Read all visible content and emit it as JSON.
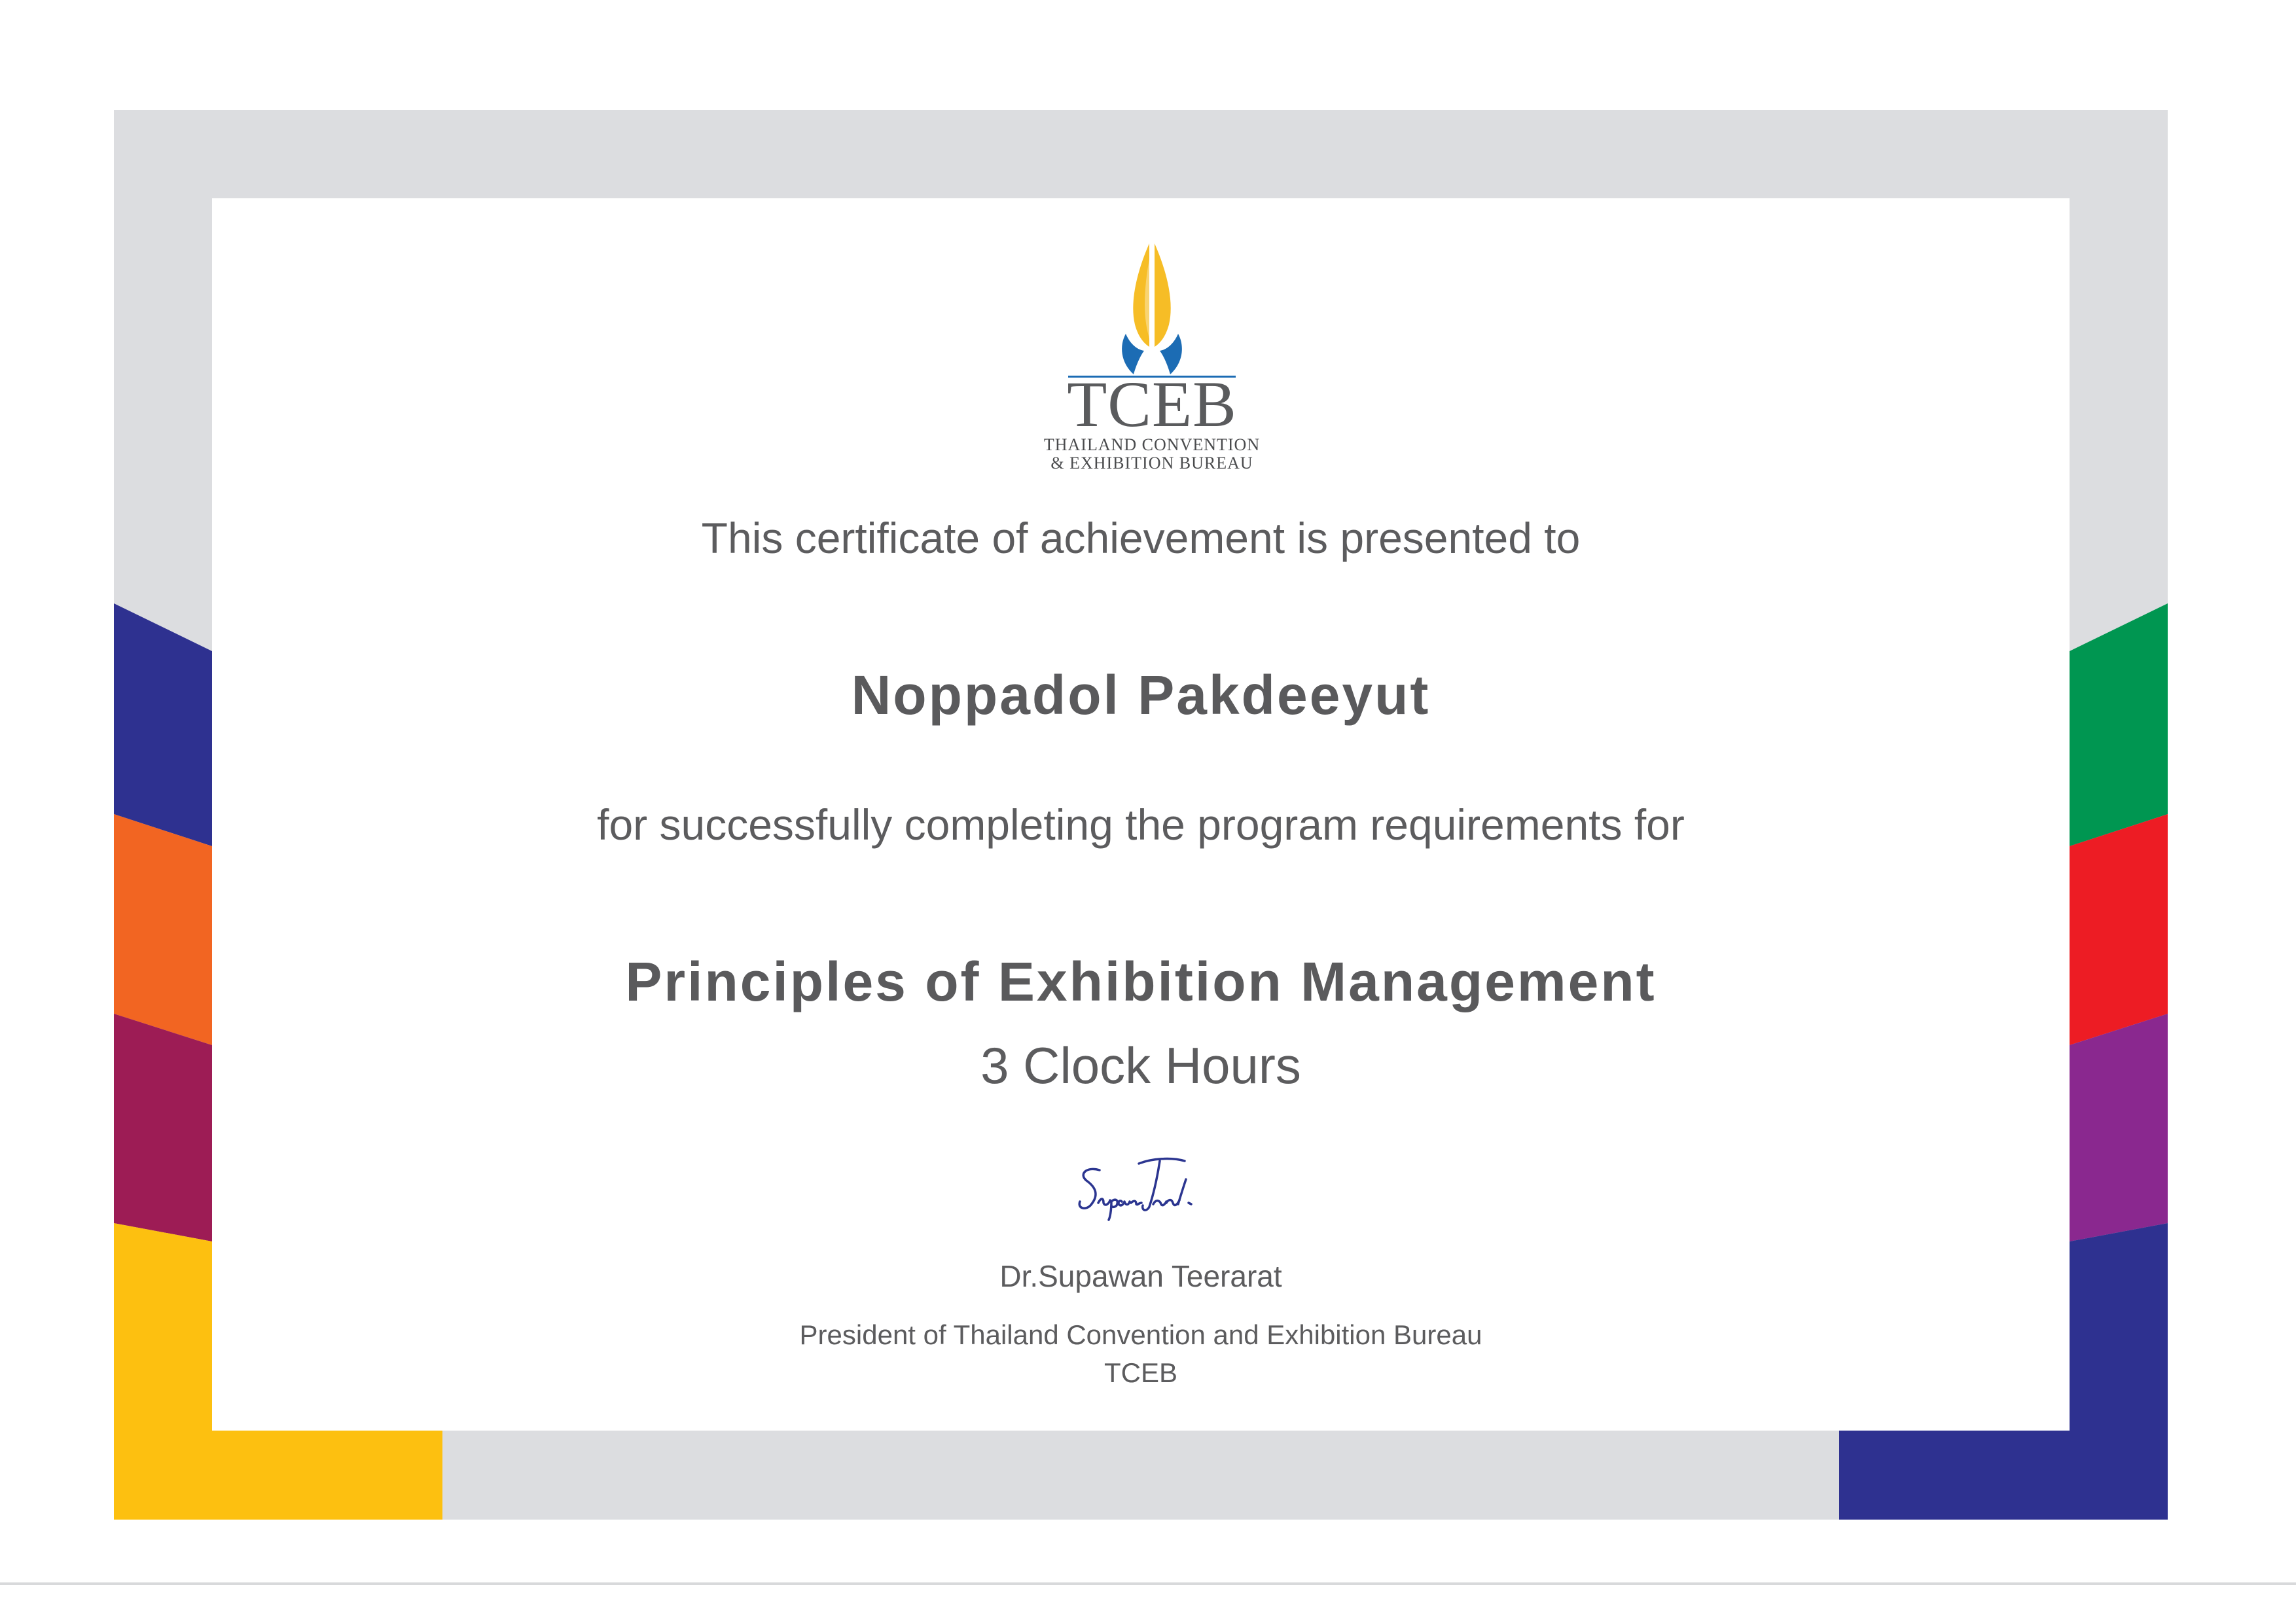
{
  "colors": {
    "frame_gray": "#dcdde0",
    "blue": "#2e3190",
    "orange": "#f26522",
    "maroon": "#9d1c55",
    "yellow": "#fdc010",
    "green": "#009651",
    "red": "#ed1c24",
    "purple": "#8a288f",
    "text": "#5c5c5e",
    "logo_gold": "#f6bd26",
    "logo_blue": "#1c6cb4"
  },
  "logo": {
    "wordmark": "TCEB",
    "subtitle_line1": "THAILAND CONVENTION",
    "subtitle_line2": "& EXHIBITION BUREAU",
    "icon": "praying-hands-icon"
  },
  "certificate": {
    "intro": "This certificate of achievement is presented to",
    "recipient": "Noppadol Pakdeeyut",
    "reason": "for successfully completing the program requirements for",
    "course": "Principles of Exhibition Management",
    "hours": "3 Clock Hours"
  },
  "signatory": {
    "name": "Dr.Supawan Teerarat",
    "title": "President of Thailand Convention and Exhibition Bureau",
    "organization": "TCEB"
  }
}
